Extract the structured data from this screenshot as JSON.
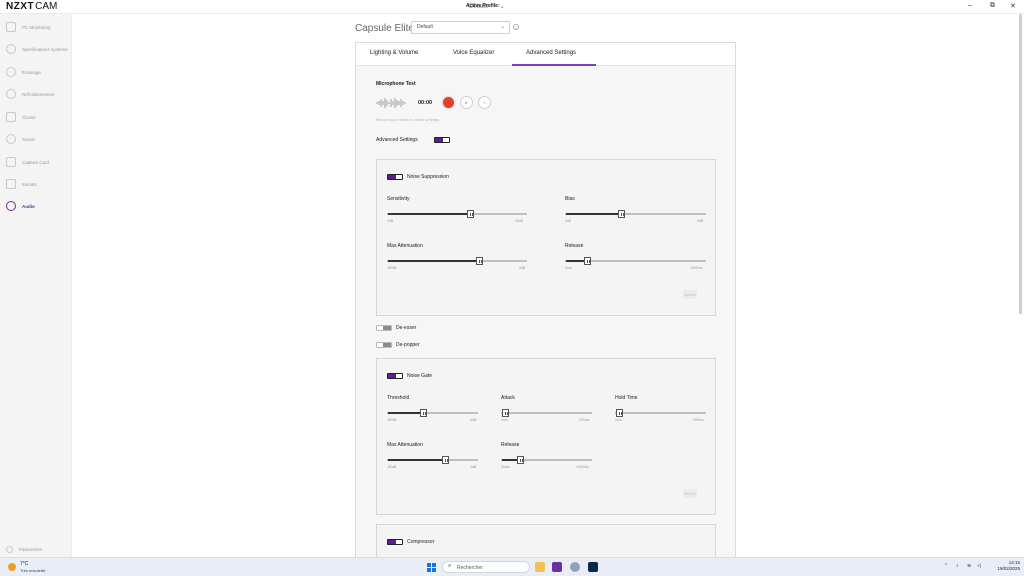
{
  "app": {
    "logo_bold": "NZXT",
    "logo_light": "CAM",
    "active_profile_label": "Active Profile:",
    "active_profile_value": "Default",
    "window_controls": [
      "–",
      "⧉",
      "✕"
    ]
  },
  "sidebar": {
    "items": [
      {
        "label": "PC Monitoring",
        "icon": "chart-line-icon"
      },
      {
        "label": "Spécifications système",
        "icon": "eye-icon"
      },
      {
        "label": "Éclairage",
        "icon": "sun-icon"
      },
      {
        "label": "Refroidissement",
        "icon": "fan-icon"
      },
      {
        "label": "Clavier",
        "icon": "keyboard-icon"
      },
      {
        "label": "Souris",
        "icon": "mouse-icon"
      },
      {
        "label": "Capture Card",
        "icon": "capture-card-icon"
      },
      {
        "label": "Monitor",
        "icon": "monitor-icon"
      },
      {
        "label": "Audio",
        "icon": "headset-icon",
        "active": true
      }
    ],
    "settings_label": "Paramètres"
  },
  "device": {
    "name": "Capsule Elite",
    "profile_select": "Default"
  },
  "tabs": [
    {
      "label": "Lighting & Volume"
    },
    {
      "label": "Voice Equalizer"
    },
    {
      "label": "Advanced Settings",
      "active": true
    }
  ],
  "mic_test": {
    "title": "Microphone Test",
    "time": "00:00",
    "hint": "Record your voice to check settings"
  },
  "advanced_settings": {
    "label": "Advanced Settings",
    "enabled": true
  },
  "noise_suppression": {
    "label": "Noise Suppression",
    "enabled": true,
    "sliders": {
      "sensitivity": {
        "label": "Sensitivity",
        "min": "0dB",
        "max": "40dB",
        "value_fraction": 0.6
      },
      "bias": {
        "label": "Bias",
        "min": "0dB",
        "max": "5dB",
        "value_fraction": 0.4
      },
      "max_attenuation": {
        "label": "Max Attenuation",
        "min": "-80dB",
        "max": "0dB",
        "value_fraction": 0.67
      },
      "release": {
        "label": "Release",
        "min": "0ms",
        "max": "1000ms",
        "value_fraction": 0.16
      }
    },
    "reset_label": "Initialis"
  },
  "de_esser": {
    "label": "De-esser",
    "enabled": false
  },
  "de_popper": {
    "label": "De-popper",
    "enabled": false
  },
  "noise_gate": {
    "label": "Noise Gate",
    "enabled": true,
    "sliders": {
      "threshold": {
        "label": "Threshold",
        "min": "-80dB",
        "max": "-5dB",
        "value_fraction": 0.4
      },
      "attack": {
        "label": "Attack",
        "min": "0ms",
        "max": "200ms",
        "value_fraction": 0.02
      },
      "hold_time": {
        "label": "Hold Time",
        "min": "0ms",
        "max": "200ms",
        "value_fraction": 0.03
      },
      "max_attenuation": {
        "label": "Max Attenuation",
        "min": "-80dB",
        "max": "0dB",
        "value_fraction": 0.65
      },
      "release": {
        "label": "Release",
        "min": "50ms",
        "max": "1000ms",
        "value_fraction": 0.21
      }
    },
    "reset_label": "Initialis"
  },
  "compressor": {
    "label": "Compressor",
    "enabled": true
  },
  "taskbar": {
    "weather_temp": "7°C",
    "weather_desc": "Très ensoleillé",
    "search_placeholder": "Rechercher",
    "time": "14:15",
    "date": "19/02/2025"
  },
  "colors": {
    "accent": "#5a1f8c",
    "tab_underline": "#7b3fbf",
    "record": "#e53d2a"
  }
}
